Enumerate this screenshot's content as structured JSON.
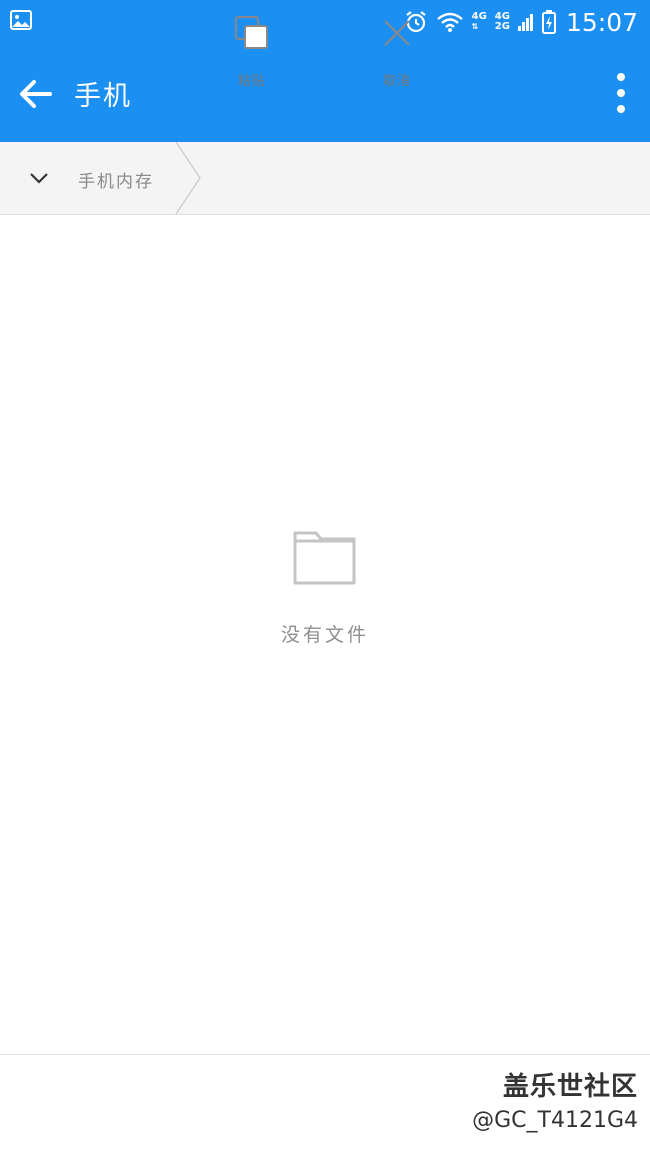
{
  "status_bar": {
    "net1": "4G",
    "net2_top": "4G",
    "net2_bottom": "2G",
    "time": "15:07",
    "icons": [
      "gallery-icon",
      "alarm-icon",
      "wifi-icon",
      "signal-icon",
      "battery-icon"
    ]
  },
  "app_bar": {
    "title": "手机",
    "back_icon": "arrow-left-icon",
    "more_icon": "more-vertical-icon"
  },
  "breadcrumb": {
    "items": [
      {
        "label": "手机内存"
      }
    ]
  },
  "empty_state": {
    "icon": "folder-icon",
    "text": "没有文件"
  },
  "bottom_bar": {
    "paste_label": "粘贴",
    "cancel_label": "取消"
  },
  "watermark": {
    "line1": "盖乐世社区",
    "line2": "@GC_T4121G4"
  },
  "colors": {
    "primary": "#1b8ff2",
    "breadcrumb_bg": "#f4f4f4",
    "muted_text": "#8f8f8f"
  }
}
